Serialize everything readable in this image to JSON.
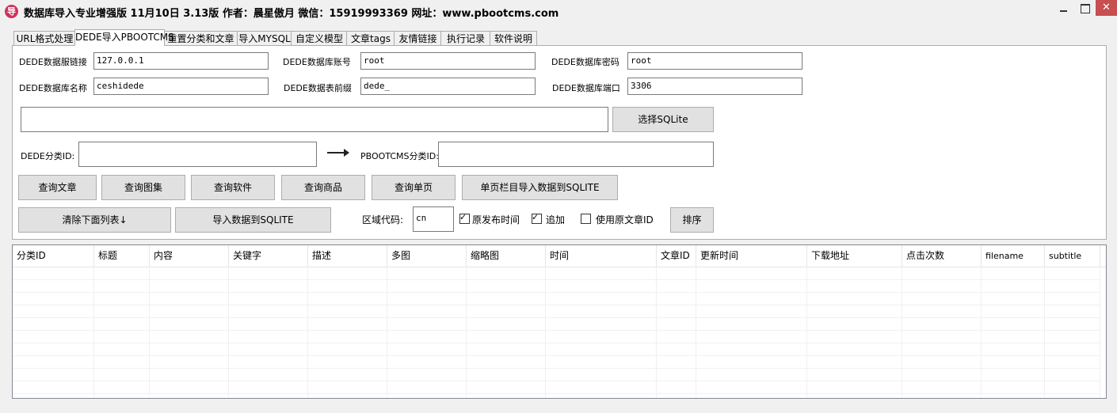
{
  "window": {
    "icon_glyph": "导",
    "title": "数据库导入专业增强版 11月10日 3.13版 作者：晨星傲月 微信：15919993369 网址：www.pbootcms.com",
    "close_glyph": "✕"
  },
  "tabs": [
    {
      "label": "URL格式处理",
      "active": false
    },
    {
      "label": "DEDE导入PBOOTCMS",
      "active": true
    },
    {
      "label": "重置分类和文章",
      "active": false
    },
    {
      "label": "导入MYSQL",
      "active": false
    },
    {
      "label": "自定义模型",
      "active": false
    },
    {
      "label": "文章tags",
      "active": false
    },
    {
      "label": "友情链接",
      "active": false
    },
    {
      "label": "执行记录",
      "active": false
    },
    {
      "label": "软件说明",
      "active": false
    }
  ],
  "form": {
    "host_label": "DEDE数据服链接",
    "host_value": "127.0.0.1",
    "user_label": "DEDE数据库账号",
    "user_value": "root",
    "password_label": "DEDE数据库密码",
    "password_value": "root",
    "dbname_label": "DEDE数据库名称",
    "dbname_value": "ceshidede",
    "prefix_label": "DEDE数据表前缀",
    "prefix_value": "dede_",
    "port_label": "DEDE数据库端口",
    "port_value": "3306",
    "sqlite_path_value": "",
    "select_sqlite_button": "选择SQLite",
    "dede_category_label": "DEDE分类ID:",
    "dede_category_value": "",
    "pboot_category_label": "PBOOTCMS分类ID:",
    "pboot_category_value": ""
  },
  "buttons": {
    "query_articles": "查询文章",
    "query_albums": "查询图集",
    "query_software": "查询软件",
    "query_products": "查询商品",
    "query_singlepage": "查询单页",
    "import_singlepage": "单页栏目导入数据到SQLITE",
    "clear_list": "清除下面列表↓",
    "import_sqlite": "导入数据到SQLITE",
    "sort": "排序"
  },
  "options": {
    "region_label": "区域代码:",
    "region_value": "cn",
    "original_time_label": "原发布时间",
    "original_time_checked": true,
    "append_label": "追加",
    "append_checked": true,
    "use_original_id_label": "使用原文章ID",
    "use_original_id_checked": false,
    "check_glyph": "✓"
  },
  "grid": {
    "columns": [
      "分类ID",
      "标题",
      "内容",
      "关键字",
      "描述",
      "多图",
      "缩略图",
      "时间",
      "文章ID",
      "更新时间",
      "下载地址",
      "点击次数",
      "filename",
      "subtitle"
    ],
    "rows": []
  }
}
